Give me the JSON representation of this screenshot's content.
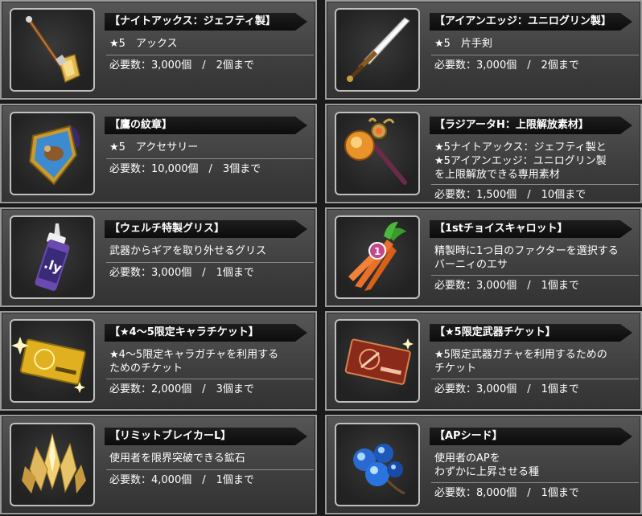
{
  "items": [
    {
      "title": "【ナイトアックス：ジェフティ製】",
      "desc": "★5　アックス",
      "req": "必要数：3,000個　/　2個まで",
      "icon": "axe-icon"
    },
    {
      "title": "【アイアンエッジ：ユニログリン製】",
      "desc": "★5　片手剣",
      "req": "必要数：3,000個　/　2個まで",
      "icon": "sword-icon"
    },
    {
      "title": "【鷹の紋章】",
      "desc": "★5　アクセサリー",
      "req": "必要数：10,000個　/　3個まで",
      "icon": "crest-icon"
    },
    {
      "title": "【ラジアータH：上限解放素材】",
      "desc": "★5ナイトアックス：ジェフティ製と\n★5アイアンエッジ：ユニログリン製\nを上限解放できる専用素材",
      "req": "必要数：1,500個　/　10個まで",
      "icon": "hammer-icon"
    },
    {
      "title": "【ウェルチ特製グリス】",
      "desc": "武器からギアを取り外せるグリス",
      "req": "必要数：3,000個　/　1個まで",
      "icon": "grease-tube-icon"
    },
    {
      "title": "【1stチョイスキャロット】",
      "desc": "精製時に1つ目のファクターを選択する\nバーニィのエサ",
      "req": "必要数：3,000個　/　1個まで",
      "icon": "carrot-icon"
    },
    {
      "title": "【★4～5限定キャラチケット】",
      "desc": "★4～5限定キャラガチャを利用する\nためのチケット",
      "req": "必要数：2,000個　/　3個まで",
      "icon": "gold-ticket-icon"
    },
    {
      "title": "【★5限定武器チケット】",
      "desc": "★5限定武器ガチャを利用するための\nチケット",
      "req": "必要数：3,000個　/　1個まで",
      "icon": "bronze-ticket-icon"
    },
    {
      "title": "【リミットブレイカーL】",
      "desc": "使用者を限界突破できる鉱石",
      "req": "必要数：4,000個　/　1個まで",
      "icon": "crystal-icon"
    },
    {
      "title": "【APシード】",
      "desc": "使用者のAPを\nわずかに上昇させる種",
      "req": "必要数：8,000個　/　1個まで",
      "icon": "seed-icon"
    }
  ]
}
